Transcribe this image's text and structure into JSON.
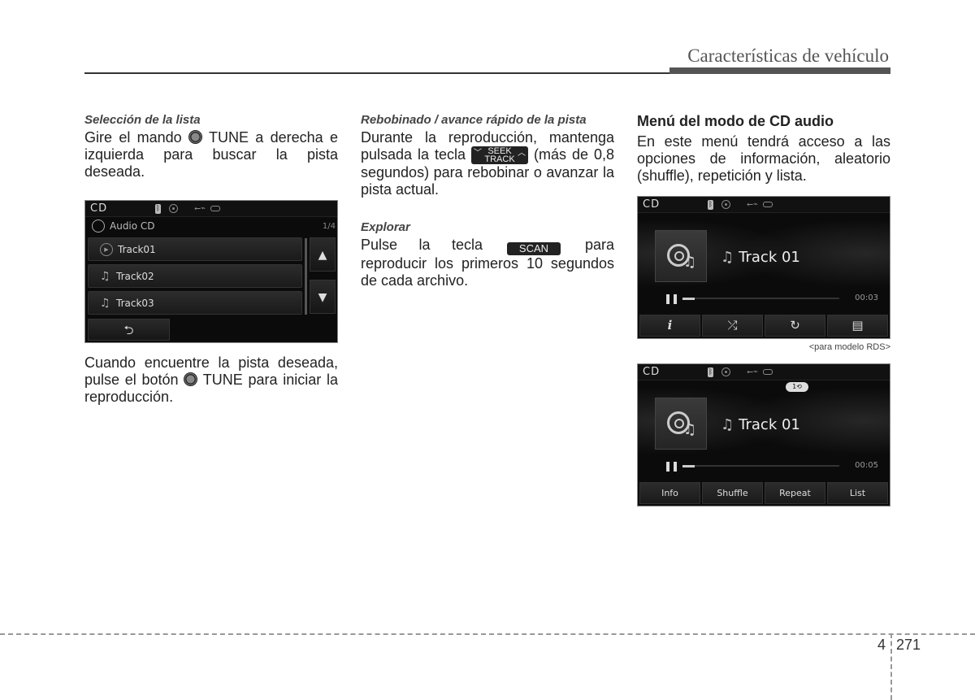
{
  "header": {
    "title": "Características de vehículo"
  },
  "col1": {
    "subhead": "Selección de la lista",
    "para1_a": "Gire el mando",
    "para1_b": "TUNE a derecha e izquierda para buscar la pista deseada.",
    "list_screen": {
      "status_label": "CD",
      "sub_label": "Audio CD",
      "page": "1/4",
      "tracks": [
        "Track01",
        "Track02",
        "Track03"
      ],
      "up_icon": "▲",
      "down_icon": "▼",
      "back_icon": "⮌"
    },
    "para2_a": "Cuando encuentre la pista deseada, pulse el botón",
    "para2_b": "TUNE para iniciar la reproducción."
  },
  "col2": {
    "subhead1": "Rebobinado / avance rápido de la pista",
    "para1_a": "Durante la reproducción, mantenga pulsada la tecla",
    "seek_key_top": "SEEK",
    "seek_key_bottom": "TRACK",
    "para1_b": "(más de 0,8 segundos) para rebobinar o avanzar la pista actual.",
    "subhead2": "Explorar",
    "para2_a": "Pulse la tecla",
    "scan_key": "SCAN",
    "para2_b": "para reproducir los primeros 10 segundos de cada archivo."
  },
  "col3": {
    "heading": "Menú del modo de CD audio",
    "para": "En este menú tendrá acceso a las opciones de información, aleatorio (shuffle), repetición y lista.",
    "player1": {
      "status_label": "CD",
      "track": "Track 01",
      "time": "00:03",
      "progress": 0.08,
      "buttons": [
        "i",
        "⤮",
        "↻",
        "▤"
      ],
      "button_icons": [
        "info-icon",
        "shuffle-icon",
        "repeat-icon",
        "list-icon"
      ]
    },
    "caption": "<para modelo RDS>",
    "player2": {
      "status_label": "CD",
      "repeat_badge": "1⟲",
      "track": "Track 01",
      "time": "00:05",
      "progress": 0.08,
      "buttons": [
        "Info",
        "Shuffle",
        "Repeat",
        "List"
      ]
    }
  },
  "footer": {
    "chapter": "4",
    "page": "271"
  }
}
